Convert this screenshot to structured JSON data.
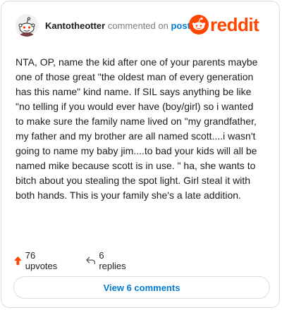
{
  "comment": {
    "username": "Kantotheotter",
    "action_text": "commented on",
    "post_link": "post",
    "body": "NTA, OP, name the kid after one of your parents maybe one of those great \"the oldest man of every generation has this name\" kind name. If SIL says anything be like \"no telling if you would ever have (boy/girl) so i wanted to make sure the family name lived on \"my grandfather, my father and my brother are all named scott....i wasn't going to name my baby jim....to bad your kids will all be named mike because scott is in use. \" ha, she wants to bitch about you stealing the spot light. Girl steal it with both hands. This is your family she's a late addition."
  },
  "brand": {
    "wordmark": "reddit",
    "color": "#ff4500"
  },
  "actions": {
    "upvotes_label": "76 upvotes",
    "replies_label": "6 replies",
    "upvote_icon": "upvote-arrow-icon",
    "reply_icon": "reply-arrow-icon"
  },
  "view_comments_label": "View 6 comments",
  "colors": {
    "link": "#0079d3",
    "upvote": "#ff4500",
    "text": "#1c1c1c",
    "muted": "#7c7c7c"
  }
}
